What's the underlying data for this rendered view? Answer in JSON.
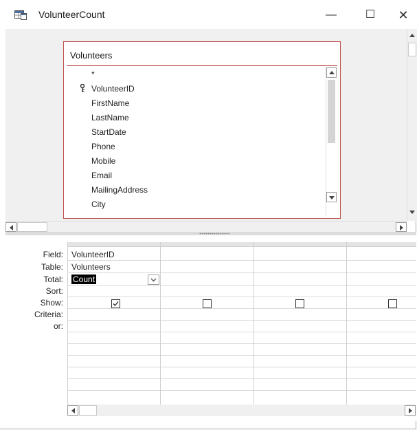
{
  "window": {
    "title": "VolunteerCount",
    "icon": "query-icon",
    "controls": {
      "minimize": "—",
      "maximize": "☐",
      "close": "✕"
    }
  },
  "table": {
    "name": "Volunteers",
    "fields": [
      "*",
      "VolunteerID",
      "FirstName",
      "LastName",
      "StartDate",
      "Phone",
      "Mobile",
      "Email",
      "MailingAddress",
      "City"
    ],
    "primary_key": "VolunteerID"
  },
  "grid": {
    "row_labels": [
      "Field:",
      "Table:",
      "Total:",
      "Sort:",
      "Show:",
      "Criteria:",
      "or:"
    ],
    "columns": [
      {
        "field": "VolunteerID",
        "table": "Volunteers",
        "total": "Count",
        "show": true
      },
      {
        "field": "",
        "table": "",
        "total": "",
        "show": false
      },
      {
        "field": "",
        "table": "",
        "total": "",
        "show": false
      },
      {
        "field": "",
        "table": "",
        "total": "",
        "show": false
      }
    ]
  },
  "colors": {
    "table_border": "#c0504d",
    "pane_bg": "#f0f0f0"
  }
}
